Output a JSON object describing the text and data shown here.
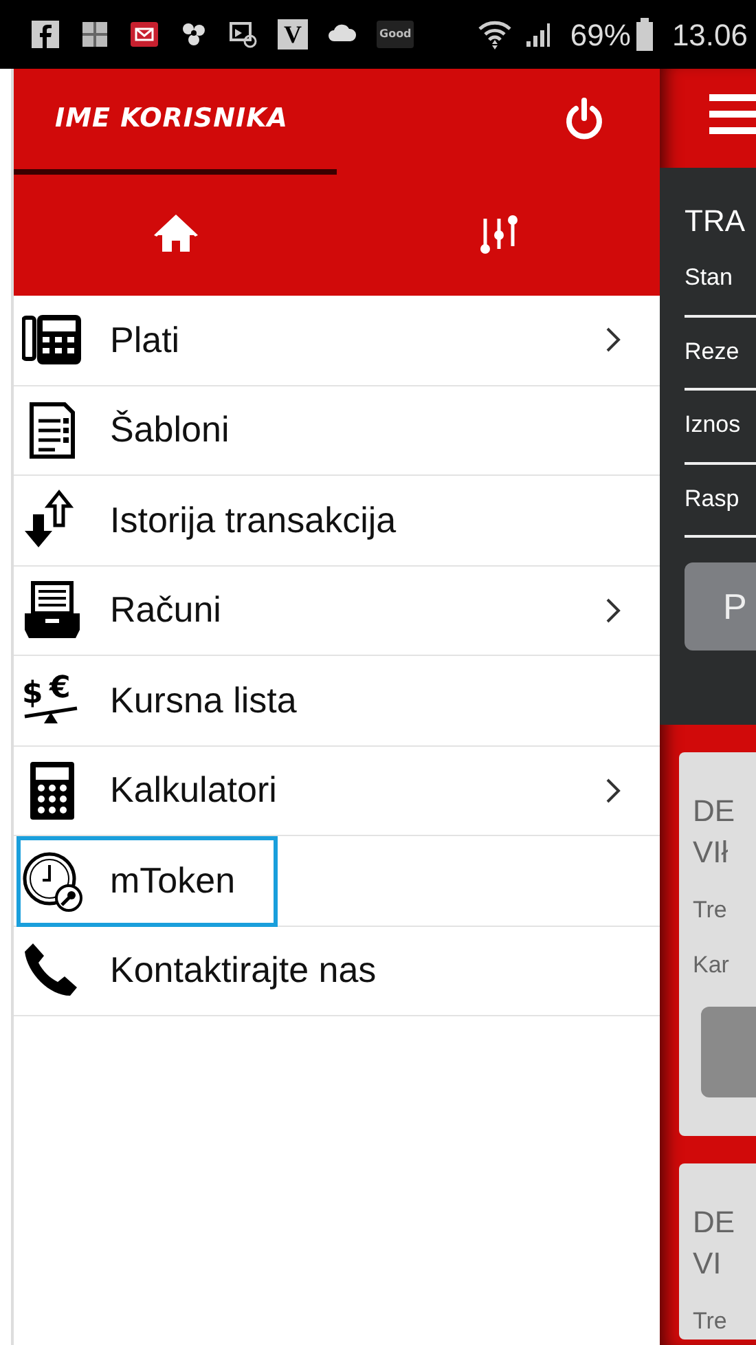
{
  "status_bar": {
    "notification_icons": [
      {
        "kind": "facebook"
      },
      {
        "kind": "picture"
      },
      {
        "kind": "mail"
      },
      {
        "kind": "flower"
      },
      {
        "kind": "email"
      },
      {
        "kind": "letter",
        "text": "V"
      },
      {
        "kind": "cloud"
      },
      {
        "kind": "badge",
        "text": "Good"
      }
    ],
    "battery": "69%",
    "time": "13.06"
  },
  "drawer": {
    "user_name": "IME KORISNIKA",
    "tabs": [
      {
        "kind": "home",
        "selected": true
      },
      {
        "kind": "settings",
        "selected": false
      }
    ],
    "items": [
      {
        "kind": "payment",
        "label": "Plati",
        "has_submenu": true,
        "focused": false
      },
      {
        "kind": "document",
        "label": "Šabloni",
        "has_submenu": false,
        "focused": false
      },
      {
        "kind": "transfer",
        "label": "Istorija transakcija",
        "has_submenu": false,
        "focused": false
      },
      {
        "kind": "drawer",
        "label": "Računi",
        "has_submenu": true,
        "focused": false
      },
      {
        "kind": "exchange",
        "icon_symbols": [
          "$",
          "€"
        ],
        "label": "Kursna lista",
        "has_submenu": false,
        "focused": false
      },
      {
        "kind": "calculator",
        "label": "Kalkulatori",
        "has_submenu": true,
        "focused": false
      },
      {
        "kind": "clock",
        "label": "mToken",
        "has_submenu": false,
        "focused": true
      },
      {
        "kind": "phone",
        "label": "Kontaktirajte nas",
        "has_submenu": false,
        "focused": false
      }
    ]
  },
  "background_page": {
    "title": "TRA",
    "fields": [
      "Stan",
      "Reze",
      "Iznos",
      "Rasp"
    ],
    "button": "P",
    "cards": [
      {
        "title_lines": [
          "DE",
          "VIł"
        ],
        "lines": [
          "Tre",
          "Kar"
        ],
        "has_button": true
      },
      {
        "title_lines": [
          "DE",
          "VI"
        ],
        "lines": [
          "Tre"
        ],
        "has_button": false
      }
    ]
  }
}
